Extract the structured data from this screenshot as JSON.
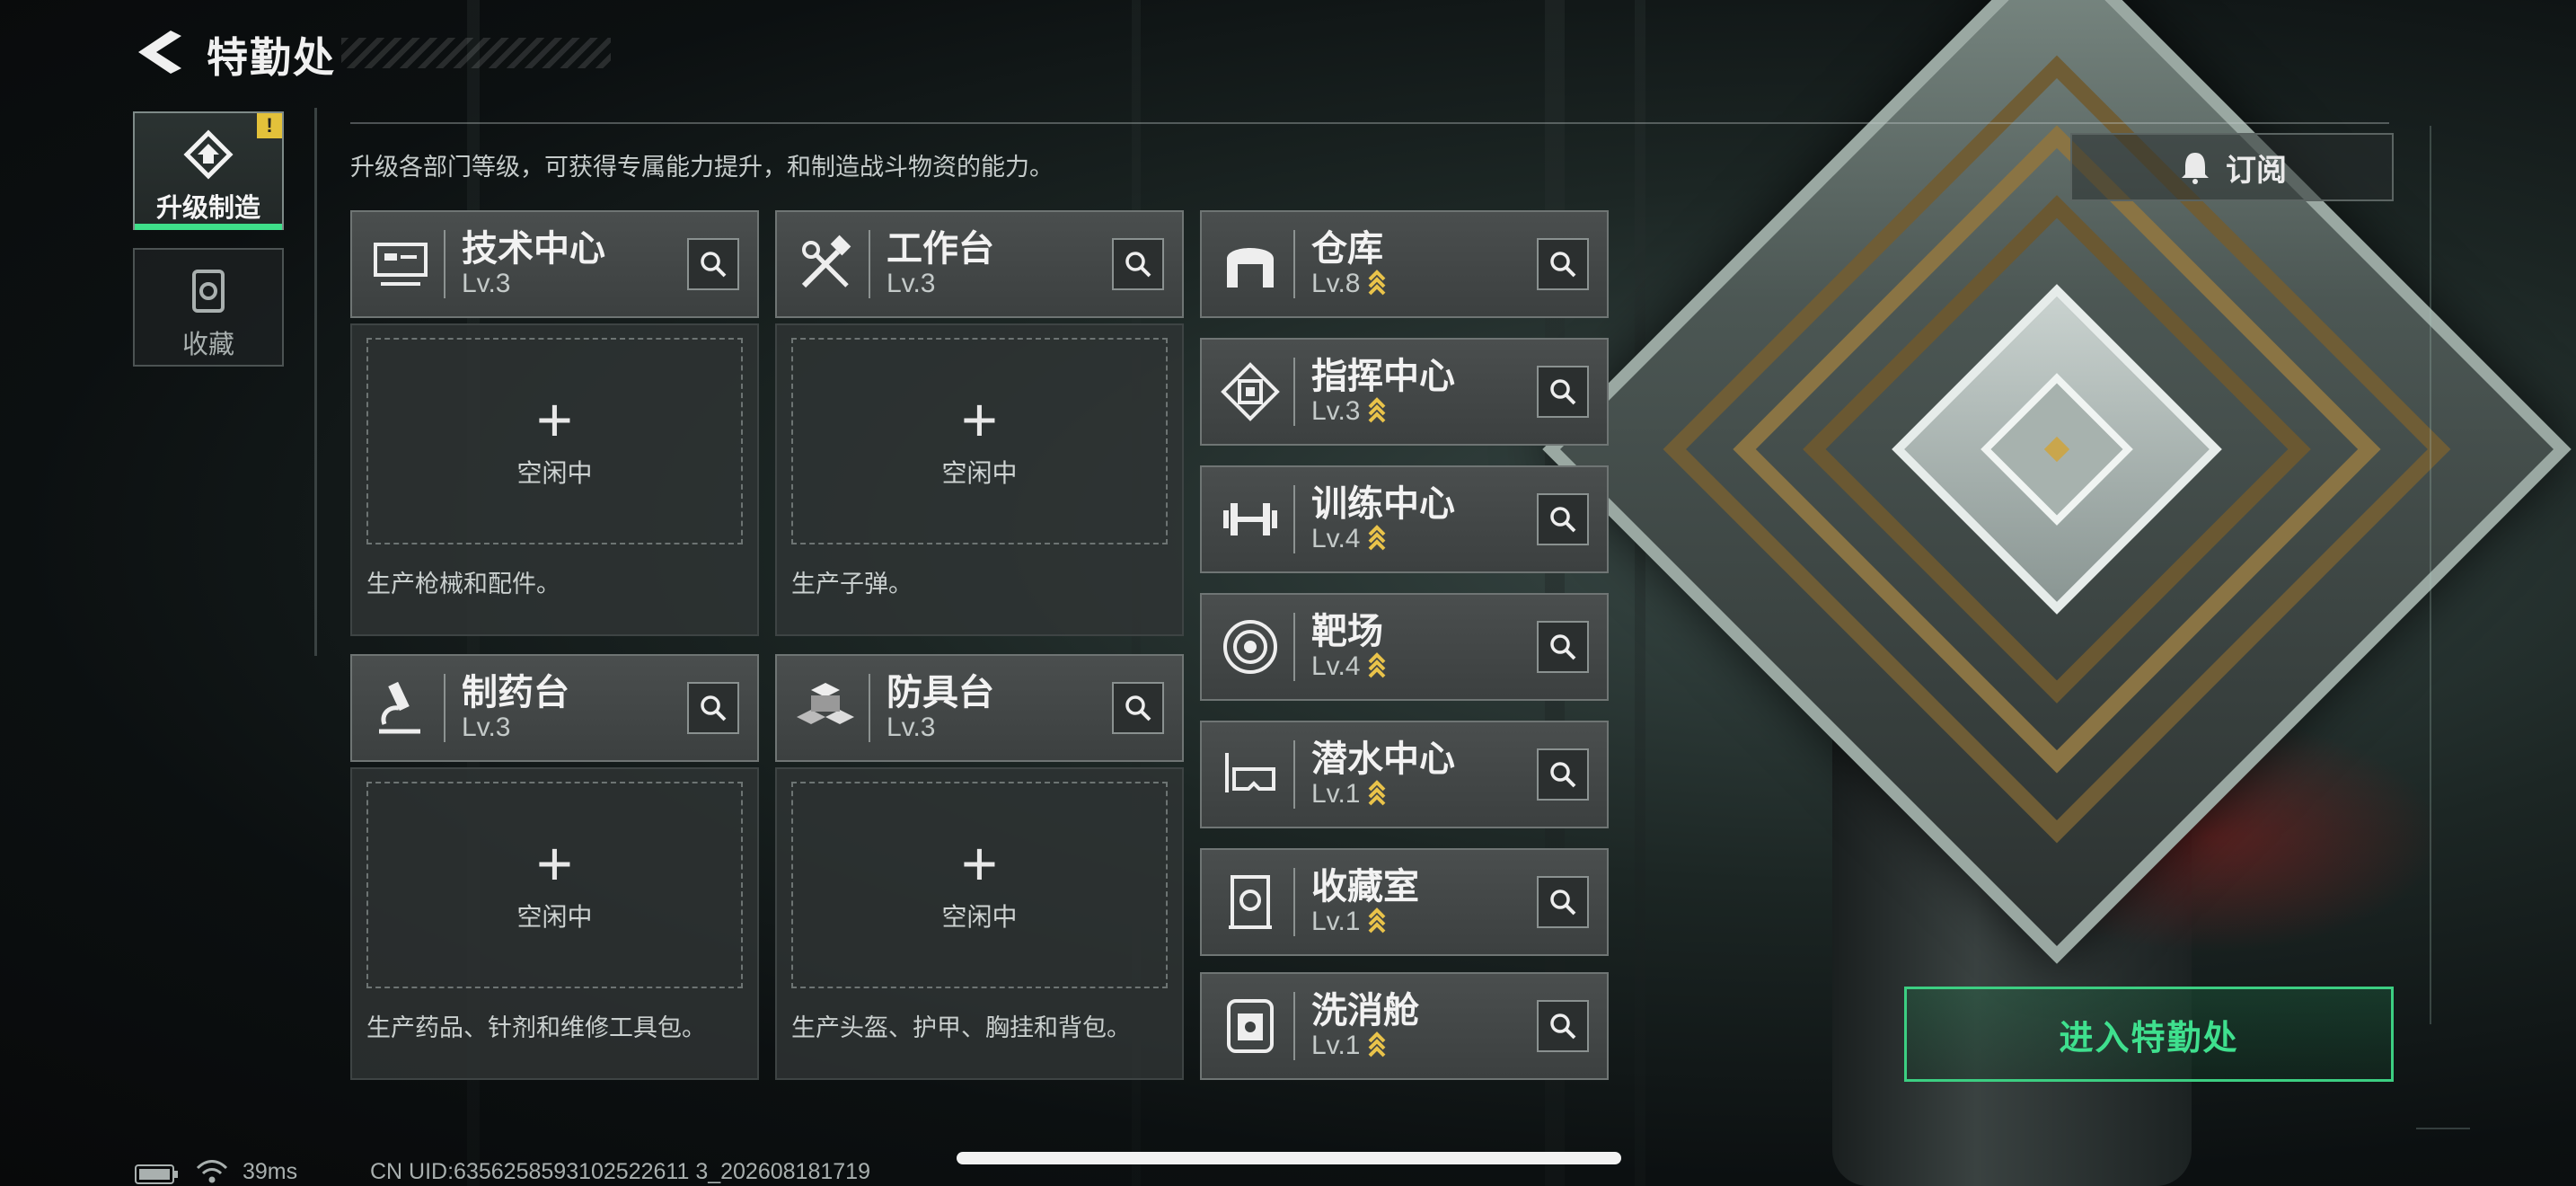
{
  "header": {
    "title": "特勤处",
    "back_icon": "back-arrow-icon"
  },
  "nav": [
    {
      "label": "升级制造",
      "icon": "upgrade-icon",
      "active": true,
      "badge": "!"
    },
    {
      "label": "收藏",
      "icon": "collection-icon",
      "active": false
    }
  ],
  "description": "升级各部门等级，可获得专属能力提升，和制造战斗物资的能力。",
  "subscribe": {
    "label": "订阅",
    "icon": "bell-icon"
  },
  "workshops": [
    {
      "name": "技术中心",
      "level": "Lv.3",
      "icon": "tech-center-icon",
      "slot_status": "空闲中",
      "description": "生产枪械和配件。"
    },
    {
      "name": "工作台",
      "level": "Lv.3",
      "icon": "tools-icon",
      "slot_status": "空闲中",
      "description": "生产子弹。"
    },
    {
      "name": "制药台",
      "level": "Lv.3",
      "icon": "microscope-icon",
      "slot_status": "空闲中",
      "description": "生产药品、针剂和维修工具包。"
    },
    {
      "name": "防具台",
      "level": "Lv.3",
      "icon": "armor-blocks-icon",
      "slot_status": "空闲中",
      "description": "生产头盔、护甲、胸挂和背包。"
    }
  ],
  "facilities": [
    {
      "name": "仓库",
      "level": "Lv.8",
      "icon": "warehouse-icon"
    },
    {
      "name": "指挥中心",
      "level": "Lv.3",
      "icon": "command-chip-icon"
    },
    {
      "name": "训练中心",
      "level": "Lv.4",
      "icon": "dumbbell-icon"
    },
    {
      "name": "靶场",
      "level": "Lv.4",
      "icon": "target-icon"
    },
    {
      "name": "潜水中心",
      "level": "Lv.1",
      "icon": "diving-mask-icon"
    },
    {
      "name": "收藏室",
      "level": "Lv.1",
      "icon": "collection-room-icon"
    },
    {
      "name": "洗消舱",
      "level": "Lv.1",
      "icon": "decon-chamber-icon"
    }
  ],
  "enter_button": "进入特勤处",
  "status_bar": {
    "ping": "39ms",
    "uid": "CN UID:6356258593102522611 3_202608181719"
  },
  "colors": {
    "accent_green": "#3fe08e",
    "upgrade_chevron": "#e9c34a",
    "warning_badge": "#e3c13a"
  }
}
